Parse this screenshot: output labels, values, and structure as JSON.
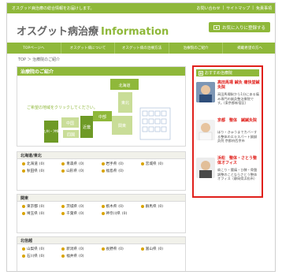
{
  "topbar": {
    "tagline": "オスグッド病治療の総合情報をお届けします。",
    "links": [
      "お問い合わせ",
      "サイトマップ",
      "免責事項"
    ]
  },
  "header": {
    "logo_jp": "オスグット病治療",
    "logo_en": "Information",
    "fav_button": "お気に入りに登録する"
  },
  "nav": {
    "items": [
      "TOPページへ",
      "オスグット病について",
      "オスグット病の治療方法",
      "治療院のご紹介",
      "掲載希望の方へ"
    ]
  },
  "breadcrumb": "TOP ＞ 治療院のご紹介",
  "map_panel": {
    "title": "治療院のご紹介",
    "hint": "ご希望の地域をクリックしてください。",
    "regions": [
      "北海道",
      "東北",
      "中部",
      "関東",
      "近畿",
      "中国",
      "四国",
      "九州・沖縄"
    ]
  },
  "regions": [
    {
      "name": "北海道/東北",
      "prefs": [
        {
          "name": "北海道",
          "count": "(0)"
        },
        {
          "name": "青森県",
          "count": "(0)"
        },
        {
          "name": "岩手県",
          "count": "(0)"
        },
        {
          "name": "宮城県",
          "count": "(0)"
        },
        {
          "name": "秋田県",
          "count": "(0)"
        },
        {
          "name": "山形県",
          "count": "(0)"
        },
        {
          "name": "福島県",
          "count": "(0)"
        }
      ]
    },
    {
      "name": "関東",
      "prefs": [
        {
          "name": "東京都",
          "count": "(0)"
        },
        {
          "name": "茨城県",
          "count": "(0)"
        },
        {
          "name": "栃木県",
          "count": "(0)"
        },
        {
          "name": "群馬県",
          "count": "(0)"
        },
        {
          "name": "埼玉県",
          "count": "(0)"
        },
        {
          "name": "千葉県",
          "count": "(0)"
        },
        {
          "name": "神奈川県",
          "count": "(0)"
        }
      ]
    },
    {
      "name": "北信越",
      "prefs": [
        {
          "name": "山梨県",
          "count": "(0)"
        },
        {
          "name": "新潟県",
          "count": "(0)"
        },
        {
          "name": "長野県",
          "count": "(0)"
        },
        {
          "name": "富山県",
          "count": "(0)"
        },
        {
          "name": "石川県",
          "count": "(0)"
        },
        {
          "name": "福井県",
          "count": "(0)"
        }
      ]
    }
  ],
  "sidebar": {
    "title": "おすすめ治療院",
    "cards": [
      {
        "name": "高田馬場 鍼灸 痛快堂鍼灸院",
        "desc": "高田馬場駅から1分にある痛み専門の鍼灸整治療院です。(東京都新宿区)"
      },
      {
        "name": "京都　整体　鍼鍼灸院",
        "desc": "ほり・きゅうまでカバーする整体のエキスパート鍼鍼灸院 京都府西京市"
      },
      {
        "name": "浜松　整体・さとう整体オフィス",
        "desc": "肩こり・腰痛・ひ膝・骨盤調整のことならさとう整体オフィス（静岡県浜松市）"
      }
    ]
  },
  "colors": {
    "brand_green": "#8fb83a",
    "highlight_red": "#e0201b",
    "dot_yellow": "#d9a400"
  }
}
